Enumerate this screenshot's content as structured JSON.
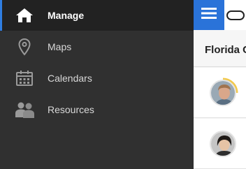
{
  "sidebar": {
    "items": [
      {
        "label": "Manage",
        "icon": "home-icon",
        "active": true
      },
      {
        "label": "Maps",
        "icon": "map-pin-icon",
        "active": false
      },
      {
        "label": "Calendars",
        "icon": "calendar-icon",
        "active": false
      },
      {
        "label": "Resources",
        "icon": "people-icon",
        "active": false
      }
    ]
  },
  "header": {
    "title": "Florida C"
  },
  "colors": {
    "accent": "#2a73d9",
    "sidebar_bg": "#303030",
    "active_bg": "#222222",
    "progress": "#f2c94c"
  }
}
